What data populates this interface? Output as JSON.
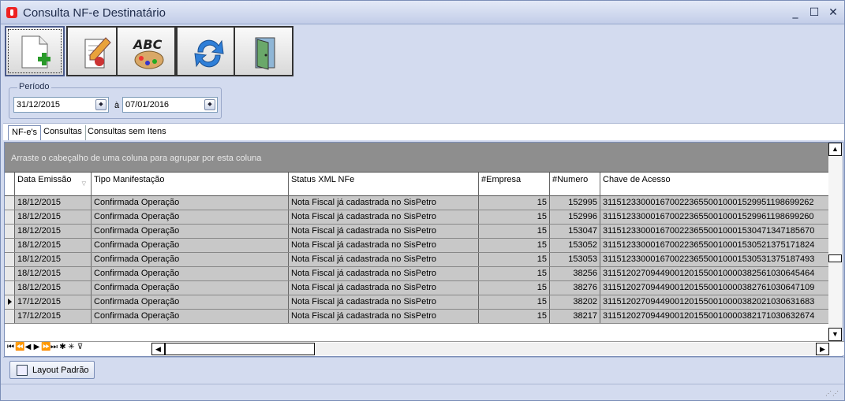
{
  "window": {
    "title": "Consulta NF-e Destinatário",
    "minimize": "_",
    "maximize": "☐",
    "close": "✕"
  },
  "toolbar": {
    "buttons": [
      "new-document-icon",
      "edit-document-icon",
      "spellcheck-palette-icon",
      "refresh-icon",
      "exit-door-icon"
    ]
  },
  "periodo": {
    "label": "Período",
    "from": "31/12/2015",
    "to_label": "à",
    "to": "07/01/2016"
  },
  "tabs": [
    "NF-e's",
    "Consultas",
    "Consultas sem Itens"
  ],
  "grid": {
    "group_hint": "Arraste o cabeçalho de uma coluna para agrupar por esta coluna",
    "columns": [
      "Data Emissão",
      "Tipo Manifestação",
      "Status XML NFe",
      "#Empresa",
      "#Numero",
      "Chave de Acesso"
    ],
    "rows": [
      [
        "18/12/2015",
        "Confirmada Operação",
        "Nota Fiscal já cadastrada no SisPetro",
        "15",
        "152995",
        "31151233000167002236550010001529951198699262"
      ],
      [
        "18/12/2015",
        "Confirmada Operação",
        "Nota Fiscal já cadastrada no SisPetro",
        "15",
        "152996",
        "31151233000167002236550010001529961198699260"
      ],
      [
        "18/12/2015",
        "Confirmada Operação",
        "Nota Fiscal já cadastrada no SisPetro",
        "15",
        "153047",
        "31151233000167002236550010001530471347185670"
      ],
      [
        "18/12/2015",
        "Confirmada Operação",
        "Nota Fiscal já cadastrada no SisPetro",
        "15",
        "153052",
        "31151233000167002236550010001530521375171824"
      ],
      [
        "18/12/2015",
        "Confirmada Operação",
        "Nota Fiscal já cadastrada no SisPetro",
        "15",
        "153053",
        "31151233000167002236550010001530531375187493"
      ],
      [
        "18/12/2015",
        "Confirmada Operação",
        "Nota Fiscal já cadastrada no SisPetro",
        "15",
        "38256",
        "31151202709449001201550010000382561030645464"
      ],
      [
        "18/12/2015",
        "Confirmada Operação",
        "Nota Fiscal já cadastrada no SisPetro",
        "15",
        "38276",
        "31151202709449001201550010000382761030647109"
      ],
      [
        "17/12/2015",
        "Confirmada Operação",
        "Nota Fiscal já cadastrada no SisPetro",
        "15",
        "38202",
        "31151202709449001201550010000382021030631683"
      ],
      [
        "17/12/2015",
        "Confirmada Operação",
        "Nota Fiscal já cadastrada no SisPetro",
        "15",
        "38217",
        "31151202709449001201550010000382171030632674"
      ]
    ],
    "current_row": 7,
    "nav": [
      "⏮",
      "⏪",
      "◀",
      "▶",
      "⏩",
      "⏭",
      "✱",
      "✳",
      "⊽"
    ]
  },
  "bottom": {
    "layout_button": "Layout Padrão"
  }
}
